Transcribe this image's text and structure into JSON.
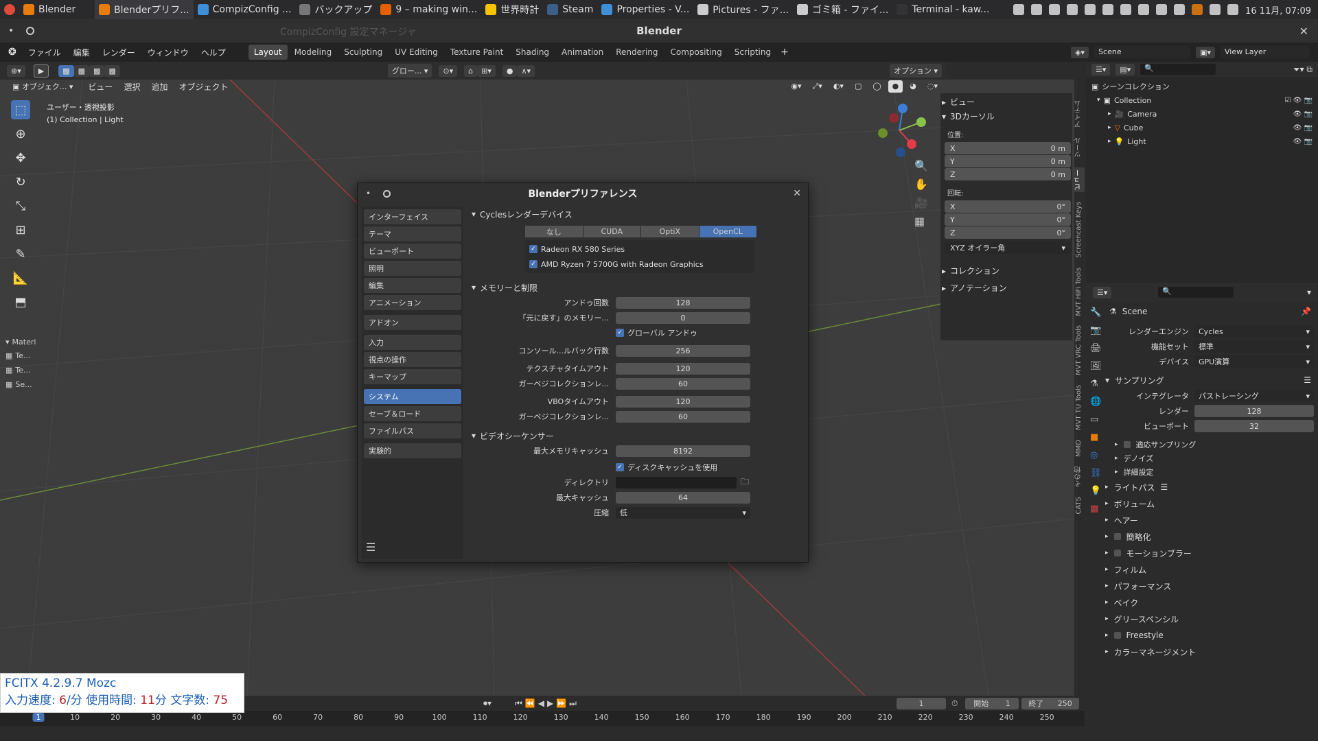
{
  "taskbar": {
    "items": [
      {
        "label": "Blender",
        "color": "#e87d0d"
      },
      {
        "label": "Blenderプリフ...",
        "color": "#e87d0d",
        "active": true
      },
      {
        "label": "CompizConfig ...",
        "color": "#3d8fd8"
      },
      {
        "label": "バックアップ",
        "color": "#777"
      },
      {
        "label": "9 – making win...",
        "color": "#e66000"
      },
      {
        "label": "世界時計",
        "color": "#f5c400"
      },
      {
        "label": "Steam",
        "color": "#3b5f87"
      },
      {
        "label": "Properties - V...",
        "color": "#3d8fd8"
      },
      {
        "label": "Pictures - ファ...",
        "color": "#ccc"
      },
      {
        "label": "ゴミ箱 - ファイ...",
        "color": "#ccc"
      },
      {
        "label": "Terminal - kaw...",
        "color": "#333"
      }
    ],
    "clock": "16 11月, 07:09"
  },
  "window": {
    "title": "Blender",
    "ghost_title": "CompizConfig 設定マネージャ"
  },
  "menubar": {
    "menus": [
      "ファイル",
      "編集",
      "レンダー",
      "ウィンドウ",
      "ヘルプ"
    ],
    "workspaces": [
      "Layout",
      "Modeling",
      "Sculpting",
      "UV Editing",
      "Texture Paint",
      "Shading",
      "Animation",
      "Rendering",
      "Compositing",
      "Scripting"
    ],
    "scene": "Scene",
    "view_layer": "View Layer"
  },
  "viewport": {
    "mode": "オブジェク...",
    "menus": [
      "ビュー",
      "選択",
      "追加",
      "オブジェクト"
    ],
    "transform": "グロー...",
    "options": "オプション",
    "info_line1": "ユーザー・透視投影",
    "info_line2": "(1) Collection | Light",
    "material_header": "Materi",
    "material_items": [
      "Te...",
      "Te...",
      "Se..."
    ]
  },
  "npanel": {
    "view": "ビュー",
    "cursor": "3Dカーソル",
    "location": "位置:",
    "loc": [
      {
        "axis": "X",
        "val": "0 m"
      },
      {
        "axis": "Y",
        "val": "0 m"
      },
      {
        "axis": "Z",
        "val": "0 m"
      }
    ],
    "rotation": "回転:",
    "rot": [
      {
        "axis": "X",
        "val": "0°"
      },
      {
        "axis": "Y",
        "val": "0°"
      },
      {
        "axis": "Z",
        "val": "0°"
      }
    ],
    "euler": "XYZ オイラー角",
    "collection": "コレクション",
    "annotation": "アノテーション",
    "tabs": [
      "アイテム",
      "ツール",
      "ビュー",
      "Screencast Keys",
      "MVT HiFi Tools",
      "MVT VRC Tools",
      "MVT TU Tools",
      "MMD",
      "その他",
      "CATS"
    ]
  },
  "outliner": {
    "root": "シーンコレクション",
    "items": [
      {
        "label": "Collection",
        "depth": 0
      },
      {
        "label": "Camera",
        "depth": 1
      },
      {
        "label": "Cube",
        "depth": 1
      },
      {
        "label": "Light",
        "depth": 1
      }
    ]
  },
  "properties": {
    "scene": "Scene",
    "rows": [
      {
        "label": "レンダーエンジン",
        "value": "Cycles"
      },
      {
        "label": "機能セット",
        "value": "標準"
      },
      {
        "label": "デバイス",
        "value": "GPU演算"
      }
    ],
    "sampling": "サンプリング",
    "integrator_label": "インテグレータ",
    "integrator": "パストレーシング",
    "render_label": "レンダー",
    "render_val": "128",
    "viewport_label": "ビューポート",
    "viewport_val": "32",
    "subsections": [
      "適応サンプリング",
      "デノイズ",
      "詳細設定"
    ],
    "sections": [
      "ライトパス",
      "ボリューム",
      "ヘアー",
      "簡略化",
      "モーションブラー",
      "フィルム",
      "パフォーマンス",
      "ベイク",
      "グリースペンシル",
      "Freestyle",
      "カラーマネージメント"
    ]
  },
  "prefs": {
    "title": "Blenderプリファレンス",
    "nav": [
      [
        "インターフェイス",
        "テーマ",
        "ビューポート",
        "照明",
        "編集",
        "アニメーション"
      ],
      [
        "アドオン"
      ],
      [
        "入力",
        "視点の操作",
        "キーマップ"
      ],
      [
        "システム",
        "セーブ＆ロード",
        "ファイルパス"
      ],
      [
        "実験的"
      ]
    ],
    "active": "システム",
    "cycles_title": "Cyclesレンダーデバイス",
    "device_tabs": [
      "なし",
      "CUDA",
      "OptiX",
      "OpenCL"
    ],
    "active_device": "OpenCL",
    "devices": [
      "Radeon RX 580 Series",
      "AMD Ryzen 7 5700G with Radeon Graphics"
    ],
    "mem_title": "メモリーと制限",
    "mem_rows": [
      {
        "label": "アンドゥ回数",
        "value": "128"
      },
      {
        "label": "「元に戻す」のメモリー...",
        "value": "0"
      }
    ],
    "global_undo": "グローバル アンドゥ",
    "mem_rows2": [
      {
        "label": "コンソール...ルバック行数",
        "value": "256"
      },
      {
        "label": "テクスチャタイムアウト",
        "value": "120"
      },
      {
        "label": "ガーベジコレクションレ...",
        "value": "60"
      },
      {
        "label": "VBOタイムアウト",
        "value": "120"
      },
      {
        "label": "ガーベジコレクションレ...",
        "value": "60"
      }
    ],
    "vse_title": "ビデオシーケンサー",
    "max_mem_label": "最大メモリキャッシュ",
    "max_mem": "8192",
    "disk_cache": "ディスクキャッシュを使用",
    "dir_label": "ディレクトリ",
    "max_cache_label": "最大キャッシュ",
    "max_cache": "64",
    "compress_label": "圧縮",
    "compress": "低"
  },
  "timeline": {
    "frame": "1",
    "start_label": "開始",
    "start": "1",
    "end_label": "終了",
    "end": "250",
    "ticks": [
      "1",
      "10",
      "20",
      "30",
      "40",
      "50",
      "60",
      "70",
      "80",
      "90",
      "100",
      "110",
      "120",
      "130",
      "140",
      "150",
      "160",
      "170",
      "180",
      "190",
      "200",
      "210",
      "220",
      "230",
      "240",
      "250"
    ]
  },
  "fcitx": {
    "line1": "FCITX 4.2.9.7 Mozc",
    "speed_label": "入力速度: ",
    "speed": "6",
    "speed_unit": "/分 使用時間: ",
    "time": "11",
    "time_unit": "分 文字数: ",
    "count": "75"
  }
}
